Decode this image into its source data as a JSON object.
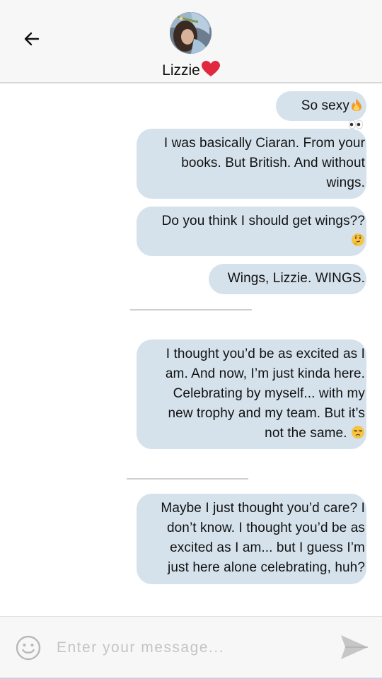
{
  "header": {
    "contact_name": "Lizzie",
    "back_icon": "arrow-left-icon",
    "status_icon": "red-heart-icon"
  },
  "messages": [
    {
      "text": "So sexy",
      "emoji": [
        "fire",
        "eyes"
      ]
    },
    {
      "text": "I was basically Ciaran. From your books. But British. And without wings."
    },
    {
      "text": "Do you think I should get wings??",
      "emoji": [
        "thinking-face"
      ]
    },
    {
      "text": "Wings, Lizzie. WINGS."
    },
    {
      "text": "I thought you’d be as excited as I am. And now, I’m just kinda here. Celebrating by myself... with my new trophy and my team. But it’s not the same.",
      "emoji": [
        "unamused-face"
      ]
    },
    {
      "text": "Maybe I just thought you’d care? I don’t know. I thought you’d be as excited as I am... but I guess I’m just here alone celebrating, huh?"
    }
  ],
  "composer": {
    "placeholder": "Enter your message...",
    "value": "",
    "emoji_icon": "smiley-icon",
    "send_icon": "send-icon"
  },
  "colors": {
    "bubble": "#d5e2ec",
    "header_bg": "#f7f7f7",
    "heart": "#e0283f",
    "placeholder": "#c4c4c4"
  }
}
